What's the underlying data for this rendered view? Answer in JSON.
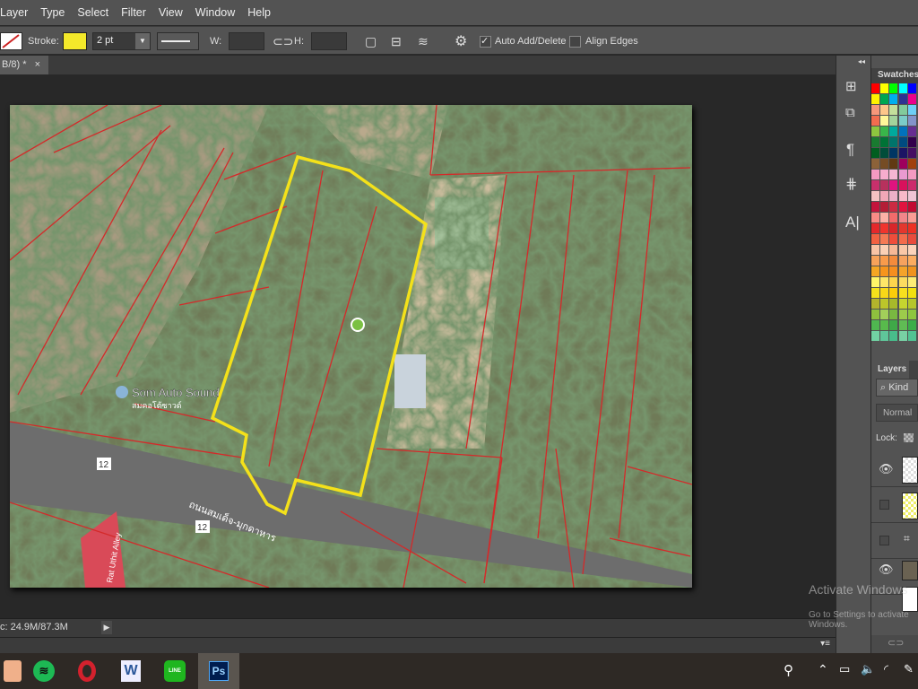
{
  "menu": [
    "Layer",
    "Type",
    "Select",
    "Filter",
    "View",
    "Window",
    "Help"
  ],
  "options": {
    "stroke_label": "Stroke:",
    "stroke_color": "#f4e92a",
    "stroke_width": "2 pt",
    "w_label": "W:",
    "h_label": "H:",
    "w_value": "",
    "h_value": "",
    "auto_add_delete": "Auto Add/Delete",
    "auto_add_checked": true,
    "align_edges": "Align Edges",
    "align_checked": false
  },
  "document": {
    "tab_label": "B/8) *",
    "close": "×"
  },
  "map": {
    "poi_label": "Som Auto Sound",
    "poi_sublabel": "สมคอโต้ซาวด์",
    "road_label": "ถนนสมเด็จ-มุกดาหาร",
    "route_number": "12",
    "alley_label": "Rat Uthit Alley",
    "parcel_color": "#d42a2a",
    "outline_color": "#f4e11a"
  },
  "status": {
    "doc_size": "c: 24.9M/87.3M"
  },
  "panels": {
    "swatches_title": "Swatches",
    "layers_title": "Layers",
    "kind_label": "Kind",
    "blend_mode": "Normal",
    "lock_label": "Lock:",
    "swatches": [
      [
        "#ff0000",
        "#ffff00",
        "#00ff00",
        "#00ffff",
        "#0000ff"
      ],
      [
        "#fff200",
        "#00a651",
        "#00aeef",
        "#2e3192",
        "#ec008c"
      ],
      [
        "#f7977a",
        "#fdc68a",
        "#c4df9b",
        "#82ca9c",
        "#6ecff6"
      ],
      [
        "#f26c4f",
        "#fff799",
        "#a3d39c",
        "#7accc8",
        "#8393ca"
      ],
      [
        "#8dc63f",
        "#39b54a",
        "#00a99d",
        "#0072bc",
        "#662d91"
      ],
      [
        "#197b30",
        "#007236",
        "#00746b",
        "#004a80",
        "#32004b"
      ],
      [
        "#005e20",
        "#004d3a",
        "#003663",
        "#1b1464",
        "#440e62"
      ],
      [
        "#8c6239",
        "#754c24",
        "#603913",
        "#9e005d",
        "#a0410d"
      ],
      [
        "#f49ac1",
        "#f6adcd",
        "#f4b6d2",
        "#ea9ad0",
        "#f49ac1"
      ],
      [
        "#c8306c",
        "#b7315d",
        "#e0137f",
        "#d8115c",
        "#cc2a6c"
      ],
      [
        "#f4c2c2",
        "#f1a7b7",
        "#ecb0c7",
        "#f8b8c8",
        "#efc4d4"
      ],
      [
        "#c4143c",
        "#b41d36",
        "#cb2b42",
        "#e0143f",
        "#c10b32"
      ],
      [
        "#f98b86",
        "#fbb1a6",
        "#f26b6b",
        "#f2868a",
        "#fa9d95"
      ],
      [
        "#e5282b",
        "#f0352d",
        "#d8262a",
        "#e3372e",
        "#ed3124"
      ],
      [
        "#f26142",
        "#f47a55",
        "#ef4d3b",
        "#f36c4c",
        "#e84c3d"
      ],
      [
        "#f9c4a5",
        "#fbd0b5",
        "#f7b896",
        "#f9c8a8",
        "#fbd3ba"
      ],
      [
        "#f7a25a",
        "#f99b4b",
        "#f48b3c",
        "#f6a25e",
        "#fbac60"
      ],
      [
        "#f5a623",
        "#f7941d",
        "#f68e1f",
        "#f5a32a",
        "#f0931f"
      ],
      [
        "#fff568",
        "#fde568",
        "#fdd54d",
        "#fbdc60",
        "#fcec75"
      ],
      [
        "#f5e21b",
        "#f8d817",
        "#fccd0a",
        "#f7df1e",
        "#f2e00f"
      ],
      [
        "#b3b42c",
        "#bcc62a",
        "#a7b92a",
        "#c5d52f",
        "#b5c72b"
      ],
      [
        "#8fc13e",
        "#a3cf5a",
        "#79b841",
        "#9dcb4b",
        "#8ec63f"
      ],
      [
        "#4fb750",
        "#58ba4c",
        "#3fa948",
        "#60bc54",
        "#3cae49"
      ],
      [
        "#71d2a3",
        "#5fc69a",
        "#48bd8b",
        "#78d0a4",
        "#51c393"
      ]
    ]
  },
  "taskbar": {
    "apps": [
      "Paint",
      "Spotify",
      "Opera",
      "Word",
      "LINE",
      "Photoshop"
    ],
    "ps_label": "Ps",
    "word_label": "W",
    "line_label": "LINE"
  },
  "watermark": {
    "line1": "Activate Windows",
    "line2": "Go to Settings to activate Windows."
  }
}
